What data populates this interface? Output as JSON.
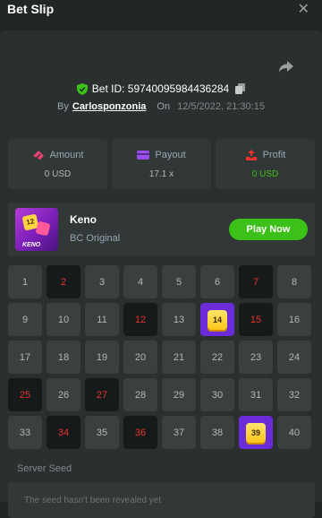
{
  "header": {
    "title": "Bet Slip",
    "close_icon": "close-icon"
  },
  "bet": {
    "id_text": "Bet ID: 59740095984436284",
    "by_label": "By",
    "username": "Carlosponzonia",
    "on_label": "On",
    "datetime": "12/5/2022, 21:30:15"
  },
  "stats": {
    "amount": {
      "label": "Amount",
      "value": "0 USD"
    },
    "payout": {
      "label": "Payout",
      "value": "17.1 x"
    },
    "profit": {
      "label": "Profit",
      "value": "0 USD"
    }
  },
  "game": {
    "thumb_number": "12",
    "thumb_caption": "KENO",
    "name": "Keno",
    "provider": "BC Original",
    "play_label": "Play Now"
  },
  "grid": {
    "numbers": [
      "1",
      "2",
      "3",
      "4",
      "5",
      "6",
      "7",
      "8",
      "9",
      "10",
      "11",
      "12",
      "13",
      "14",
      "15",
      "16",
      "17",
      "18",
      "19",
      "20",
      "21",
      "22",
      "23",
      "24",
      "25",
      "26",
      "27",
      "28",
      "29",
      "30",
      "31",
      "32",
      "33",
      "34",
      "35",
      "36",
      "37",
      "38",
      "39",
      "40"
    ],
    "picked": [
      2,
      7,
      12,
      15,
      25,
      27,
      34,
      36
    ],
    "hits": [
      14,
      39
    ]
  },
  "seed": {
    "label": "Server Seed",
    "text": "The seed hasn't been revealed yet"
  },
  "colors": {
    "accent_green": "#3bc117",
    "picked_red": "#e8332e",
    "hit_purple": "#6c2bd9",
    "gem_yellow": "#ffd640"
  }
}
